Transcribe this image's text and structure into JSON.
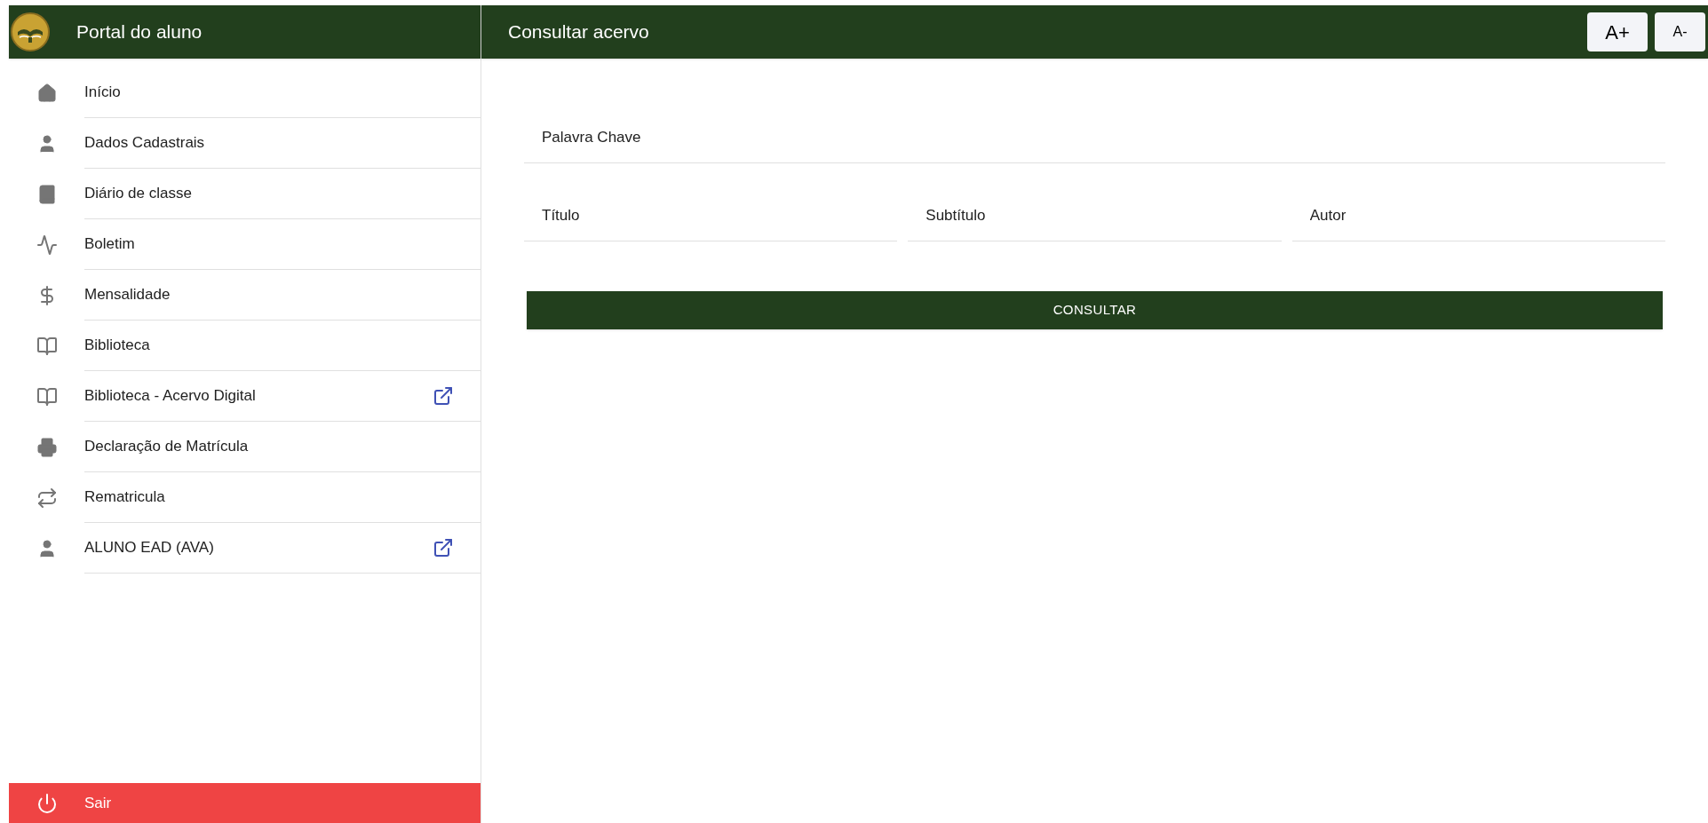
{
  "sidebar": {
    "title": "Portal do aluno",
    "items": [
      {
        "kind": "home",
        "label": "Início",
        "external": false
      },
      {
        "kind": "person",
        "label": "Dados Cadastrais",
        "external": false
      },
      {
        "kind": "book",
        "label": "Diário de classe",
        "external": false
      },
      {
        "kind": "pulse",
        "label": "Boletim",
        "external": false
      },
      {
        "kind": "money",
        "label": "Mensalidade",
        "external": false
      },
      {
        "kind": "open-book",
        "label": "Biblioteca",
        "external": false
      },
      {
        "kind": "open-book",
        "label": "Biblioteca - Acervo Digital",
        "external": true
      },
      {
        "kind": "printer",
        "label": "Declaração de Matrícula",
        "external": false
      },
      {
        "kind": "swap",
        "label": "Rematricula",
        "external": false
      },
      {
        "kind": "person",
        "label": "ALUNO EAD (AVA)",
        "external": true
      }
    ],
    "logout": "Sair"
  },
  "header": {
    "title": "Consultar acervo",
    "font_buttons": [
      "A+",
      "A-"
    ]
  },
  "form": {
    "keyword": {
      "placeholder": "Palavra Chave"
    },
    "fields": [
      {
        "placeholder": "Título"
      },
      {
        "placeholder": "Subtítulo"
      },
      {
        "placeholder": "Autor"
      }
    ],
    "submit": "CONSULTAR"
  }
}
